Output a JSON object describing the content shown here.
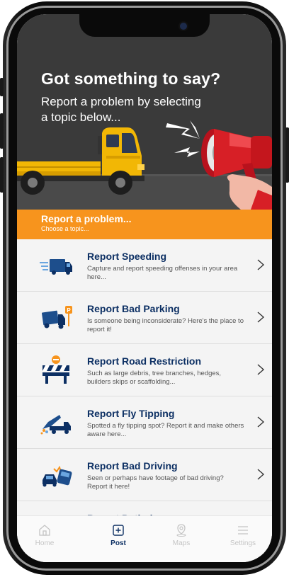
{
  "hero": {
    "title": "Got something to say?",
    "subtitle": "Report a problem by selecting a topic below..."
  },
  "band": {
    "title": "Report a problem...",
    "subtitle": "Choose a topic..."
  },
  "reports": [
    {
      "title": "Report Speeding",
      "description": "Capture and report speeding offenses in your area here...",
      "icon": "speeding-truck-icon"
    },
    {
      "title": "Report Bad Parking",
      "description": "Is someone being inconsiderate? Here's the place to report it!",
      "icon": "parking-truck-icon"
    },
    {
      "title": "Report Road Restriction",
      "description": "Such as large debris, tree branches, hedges, builders skips or scaffolding...",
      "icon": "road-barrier-icon"
    },
    {
      "title": "Report Fly Tipping",
      "description": "Spotted a fly tipping spot? Report it and make others aware here...",
      "icon": "dump-truck-icon"
    },
    {
      "title": "Report Bad Driving",
      "description": "Seen or perhaps have footage of bad driving? Report it here!",
      "icon": "collision-icon"
    },
    {
      "title": "Report Potholes",
      "description": "",
      "icon": "pothole-icon"
    }
  ],
  "tabs": [
    {
      "label": "Home",
      "icon": "home-icon",
      "active": false
    },
    {
      "label": "Post",
      "icon": "plus-square-icon",
      "active": true
    },
    {
      "label": "Maps",
      "icon": "map-pin-icon",
      "active": false
    },
    {
      "label": "Settings",
      "icon": "menu-icon",
      "active": false
    }
  ],
  "colors": {
    "hero_bg": "#3a3a3a",
    "accent_orange": "#f7941d",
    "navy": "#0c2f63",
    "list_bg": "#f4f4f4"
  }
}
